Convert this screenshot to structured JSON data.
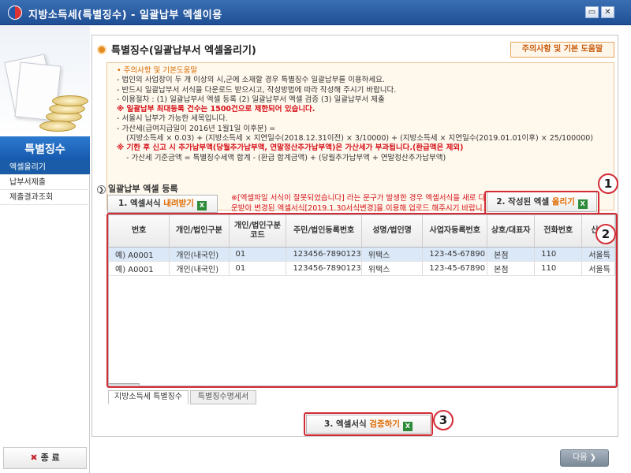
{
  "window": {
    "title": "지방소득세(특별징수) - 일괄납부 엑셀이용",
    "minimize_glyph": "▭",
    "close_glyph": "✕"
  },
  "sidebar": {
    "header": "특별징수",
    "items": [
      {
        "label": "엑셀올리기",
        "active": true
      },
      {
        "label": "납부서제출",
        "active": false
      },
      {
        "label": "제출결과조회",
        "active": false
      }
    ],
    "exit_label": "종 료"
  },
  "main": {
    "section_title": "특별징수(일괄납부서 엑셀올리기)",
    "help_button": "주의사항 및 기본 도움말",
    "notice": {
      "heading": "• 주의사항 및 기본도움말",
      "lines": [
        "- 법인의 사업장이 두 개 이상의 시,군에 소재할 경우 특별징수 일괄납부를 이용하세요.",
        "- 반드시 일괄납부서 서식을 다운로드 받으시고, 작성방법에 따라 작성해 주시기 바랍니다.",
        "- 이용절차 : (1) 일괄납부서 엑셀 등록  (2) 일괄납부서 엑셀 검증  (3) 일괄납부서 제출"
      ],
      "red_limit": "※ 일괄납부 최대등록 건수는 1500건으로 제한되어 있습니다.",
      "lines2": [
        "- 서울시 납부가 가능한 세목입니다.",
        "- 가산세(급여지급일이 2016년 1월1일 이후분) ="
      ],
      "formula": "(지방소득세 × 0.03) + (지방소득세 × 지연일수(2018.12.31이전) × 3/10000) + (지방소득세 × 지연일수(2019.01.01이후) × 25/100000)",
      "red_penalty": "※  기한 후 신고 시 추가납부액(당월추가납부액, 연말정산추가납부액)은 가산세가 부과됩니다.(환급액은 제외)",
      "base_amount": "- 가산세 기준금액 = 특별징수세액 합계 - (환급 합계금액) + (당월추가납부액 + 연말정산추가납부액)"
    },
    "upload_heading": "일괄납부 엑셀 등록",
    "download_button": {
      "prefix": "1. 엑셀서식 ",
      "highlight": "내려받기"
    },
    "warning": "※[엑셀파일 서식이 잘못되었습니다] 라는 문구가 발생한 경우 엑셀서식을 새로 다운받아 변경된 엑셀서식[2019.1.30서식변경]을 이용해 업로드 해주시기 바랍니다.",
    "upload_button": {
      "prefix": "2. 작성된 엑셀 ",
      "highlight": "올리기"
    },
    "callouts": [
      "1",
      "2",
      "3"
    ],
    "table": {
      "columns": [
        "번호",
        "개인/법인구분",
        "개인/법인구분\n코드",
        "주민/법인등록번호",
        "성명/법인명",
        "사업자등록번호",
        "상호/대표자",
        "전화번호",
        "신고"
      ],
      "rows": [
        [
          "예) A0001",
          "개인(내국인)",
          "01",
          "123456-7890123",
          "위택스",
          "123-45-67890",
          "본점",
          "110",
          "서울특"
        ],
        [
          "예) A0001",
          "개인(내국인)",
          "01",
          "123456-7890123",
          "위택스",
          "123-45-67890",
          "본점",
          "110",
          "서울특"
        ]
      ]
    },
    "tabs": [
      {
        "label": "지방소득세 특별징수",
        "active": true
      },
      {
        "label": "특별징수명세서",
        "active": false
      }
    ],
    "verify_button": {
      "prefix": "3. 엑셀서식 ",
      "highlight": "검증하기"
    }
  },
  "footer": {
    "next_label": "다음 ❯"
  },
  "colors": {
    "accent": "#1a5ca8",
    "highlight": "#e06a00",
    "warning": "#d6121a",
    "callout": "#d22c36"
  }
}
